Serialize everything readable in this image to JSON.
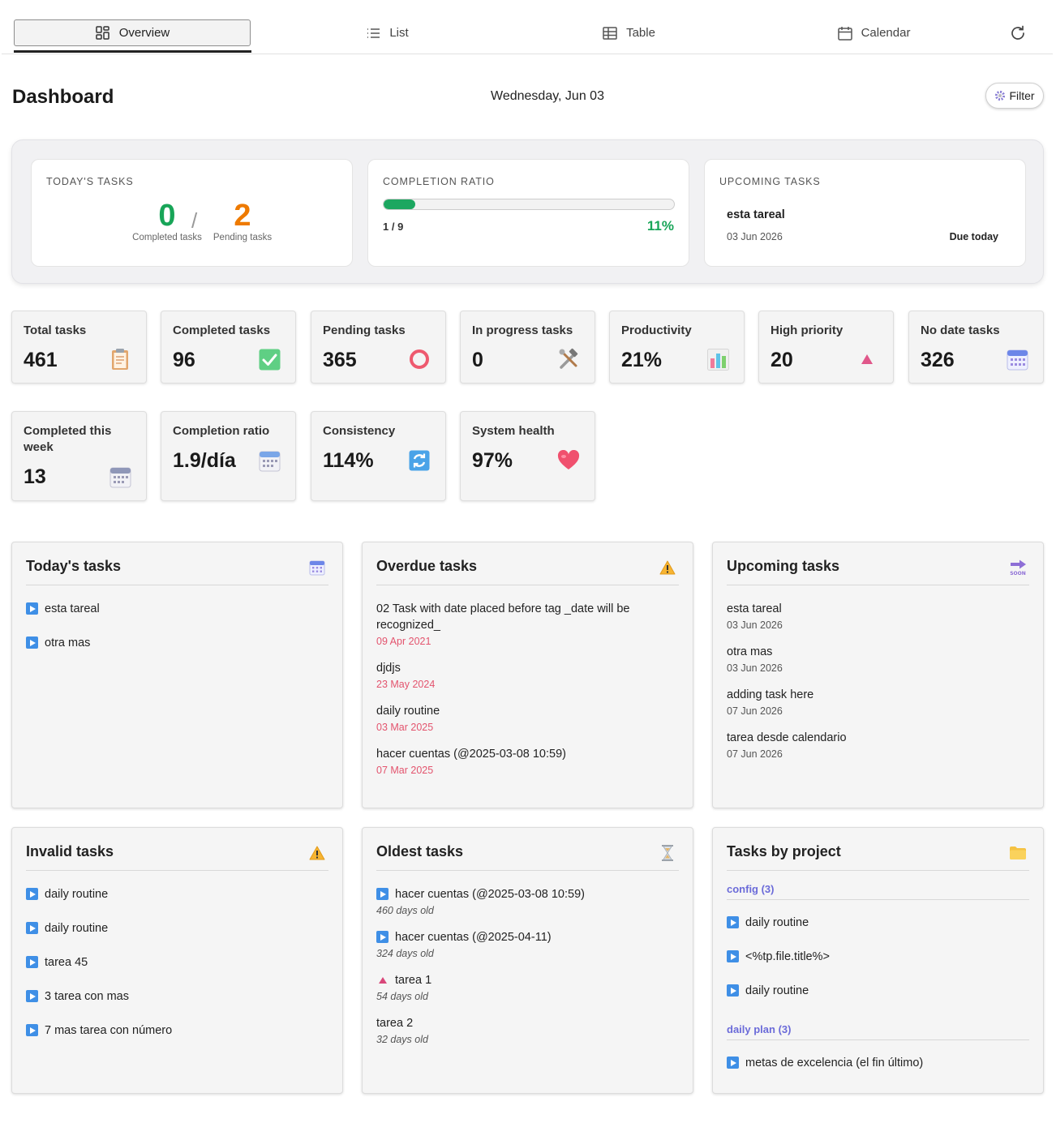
{
  "tabs": {
    "overview": "Overview",
    "list": "List",
    "table": "Table",
    "calendar": "Calendar"
  },
  "header": {
    "title": "Dashboard",
    "date": "Wednesday, Jun 03",
    "filter_label": "Filter"
  },
  "summary": {
    "today": {
      "caption": "TODAY'S TASKS",
      "completed_value": "0",
      "completed_label": "Completed tasks",
      "pending_value": "2",
      "pending_label": "Pending tasks",
      "separator": "/"
    },
    "ratio": {
      "caption": "COMPLETION RATIO",
      "progress_fraction": 0.11,
      "count": "1 / 9",
      "percent": "11%"
    },
    "upcoming": {
      "caption": "UPCOMING TASKS",
      "name": "esta tareal",
      "date": "03 Jun 2026",
      "due": "Due today"
    }
  },
  "stats": [
    {
      "label": "Total tasks",
      "value": "461",
      "icon": "clipboard-icon"
    },
    {
      "label": "Completed tasks",
      "value": "96",
      "icon": "checkmark-icon"
    },
    {
      "label": "Pending tasks",
      "value": "365",
      "icon": "ring-icon"
    },
    {
      "label": "In progress tasks",
      "value": "0",
      "icon": "tools-icon"
    },
    {
      "label": "Productivity",
      "value": "21%",
      "icon": "bar-chart-icon"
    },
    {
      "label": "High priority",
      "value": "20",
      "icon": "triangle-up-icon"
    },
    {
      "label": "No date tasks",
      "value": "326",
      "icon": "calendar-icon"
    },
    {
      "label": "Completed this week",
      "value": "13",
      "icon": "calendar-icon"
    },
    {
      "label": "Completion ratio",
      "value": "1.9/día",
      "icon": "calendar-icon"
    },
    {
      "label": "Consistency",
      "value": "114%",
      "icon": "refresh-icon"
    },
    {
      "label": "System health",
      "value": "97%",
      "icon": "heart-icon"
    }
  ],
  "panels": {
    "today": {
      "title": "Today's tasks",
      "icon": "calendar-icon",
      "items": [
        "esta tareal",
        "otra mas"
      ]
    },
    "overdue": {
      "title": "Overdue tasks",
      "icon": "warning-icon",
      "items": [
        {
          "title": "02 Task with date placed before tag _date will be recognized_",
          "date": "09 Apr 2021"
        },
        {
          "title": "djdjs",
          "date": "23 May 2024"
        },
        {
          "title": "daily routine",
          "date": "03 Mar 2025"
        },
        {
          "title": "hacer cuentas (@2025-03-08 10:59)",
          "date": "07 Mar 2025"
        }
      ]
    },
    "upcoming": {
      "title": "Upcoming tasks",
      "icon": "soon-arrow-icon",
      "items": [
        {
          "title": "esta tareal",
          "date": "03 Jun 2026"
        },
        {
          "title": "otra mas",
          "date": "03 Jun 2026"
        },
        {
          "title": "adding task here",
          "date": "07 Jun 2026"
        },
        {
          "title": "tarea desde calendario",
          "date": "07 Jun 2026"
        }
      ]
    },
    "invalid": {
      "title": "Invalid tasks",
      "icon": "warning-icon",
      "items": [
        "daily routine",
        "daily routine",
        "tarea 45",
        "3 tarea con mas",
        "7 mas tarea con número"
      ]
    },
    "oldest": {
      "title": "Oldest tasks",
      "icon": "hourglass-icon",
      "items": [
        {
          "title": "hacer cuentas (@2025-03-08 10:59)",
          "age": "460 days old",
          "marker": "play"
        },
        {
          "title": "hacer cuentas (@2025-04-11)",
          "age": "324 days old",
          "marker": "play"
        },
        {
          "title": "tarea 1",
          "age": "54 days old",
          "marker": "priority"
        },
        {
          "title": "tarea 2",
          "age": "32 days old",
          "marker": "none"
        }
      ]
    },
    "projects": {
      "title": "Tasks by project",
      "icon": "folder-icon",
      "groups": [
        {
          "name": "config (3)",
          "items": [
            "daily routine",
            "<%tp.file.title%>",
            "daily routine"
          ]
        },
        {
          "name": "daily plan (3)",
          "items": [
            "metas de excelencia (el fin último)"
          ]
        }
      ]
    }
  },
  "colors": {
    "completed_green": "#18a558",
    "pending_orange": "#ee7a00",
    "overdue_red": "#e3546e",
    "project_purple": "#6b6bd9",
    "bullet_blue": "#3f8fe6"
  }
}
